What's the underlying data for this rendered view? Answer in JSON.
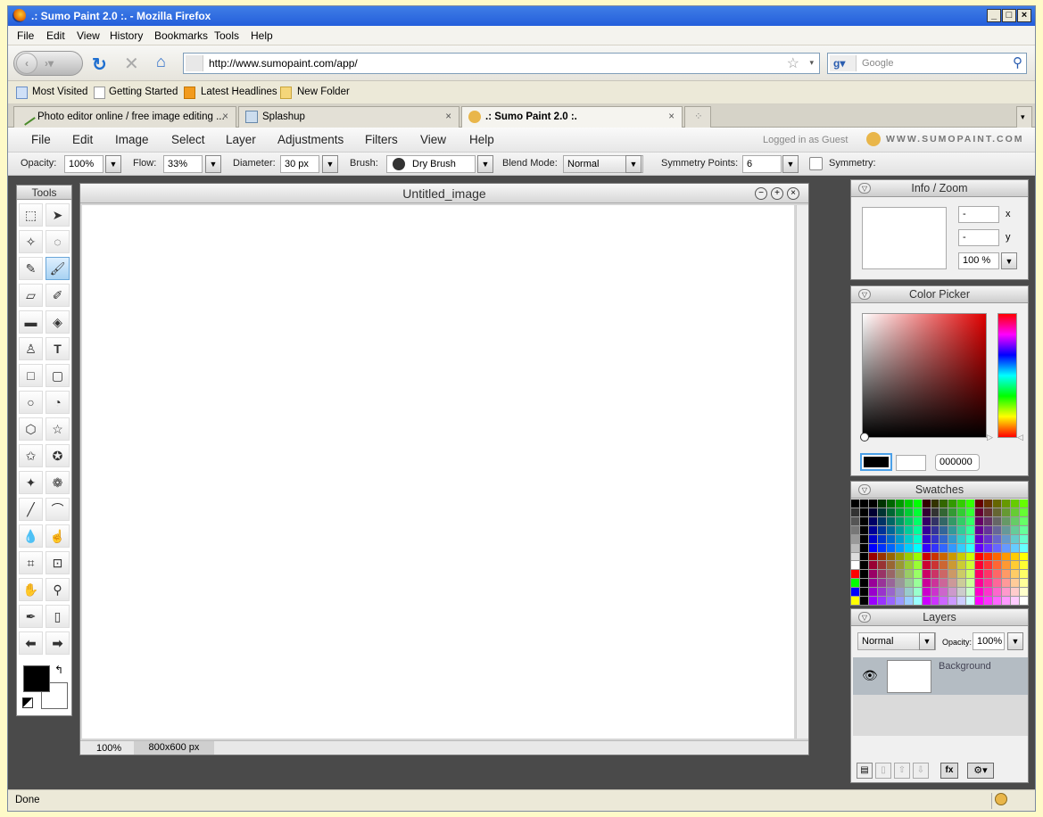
{
  "window": {
    "title": ".: Sumo Paint 2.0 :. - Mozilla Firefox"
  },
  "menubar": [
    "File",
    "Edit",
    "View",
    "History",
    "Bookmarks",
    "Tools",
    "Help"
  ],
  "nav": {
    "url": "http://www.sumopaint.com/app/",
    "search_placeholder": "Google"
  },
  "bookmarks": [
    "Most Visited",
    "Getting Started",
    "Latest Headlines",
    "New Folder"
  ],
  "tabs": [
    {
      "label": "Photo editor online / free image editing ...",
      "close": "×"
    },
    {
      "label": "Splashup",
      "close": "×"
    },
    {
      "label": ".: Sumo Paint 2.0 :.",
      "close": "×"
    }
  ],
  "app_menu": [
    "File",
    "Edit",
    "Image",
    "Select",
    "Layer",
    "Adjustments",
    "Filters",
    "View",
    "Help"
  ],
  "app_status": {
    "logged": "Logged in as Guest",
    "brand": "WWW.SUMOPAINT.COM"
  },
  "options": {
    "opacity_label": "Opacity:",
    "opacity": "100%",
    "flow_label": "Flow:",
    "flow": "33%",
    "diameter_label": "Diameter:",
    "diameter": "30 px",
    "brush_label": "Brush:",
    "brush": "Dry Brush",
    "blend_label": "Blend Mode:",
    "blend": "Normal",
    "sym_points_label": "Symmetry Points:",
    "sym_points": "6",
    "symmetry_label": "Symmetry:"
  },
  "tools_title": "Tools",
  "canvas": {
    "title": "Untitled_image",
    "zoom": "100%",
    "size": "800x600 px"
  },
  "info_panel": {
    "title": "Info / Zoom",
    "x_value": "-",
    "y_value": "-",
    "x_label": "x",
    "y_label": "y",
    "zoom": "100 %"
  },
  "color_picker": {
    "title": "Color Picker",
    "hex": "000000"
  },
  "swatches_title": "Swatches",
  "layers": {
    "title": "Layers",
    "blend": "Normal",
    "opacity_label": "Opacity:",
    "opacity": "100%",
    "layer_name": "Background"
  },
  "statusbar": "Done",
  "colors": {
    "titlebar": "#245edb",
    "app_bg": "#4a4a4a",
    "selected_tool": "#a8d2f2"
  }
}
